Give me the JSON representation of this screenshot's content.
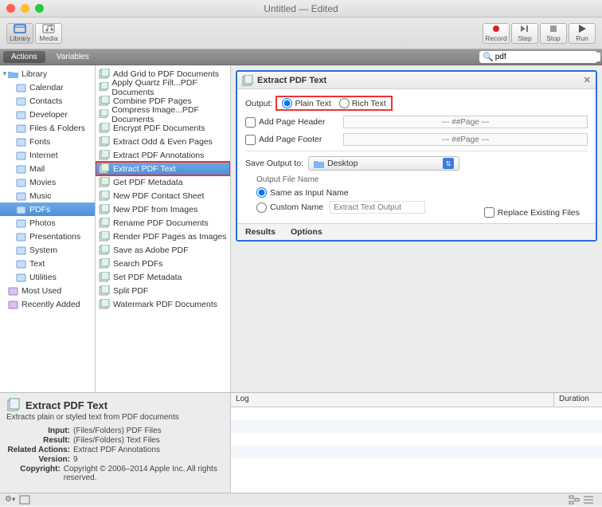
{
  "window": {
    "title": "Untitled — Edited"
  },
  "toolbar": {
    "left": [
      {
        "id": "library",
        "label": "Library"
      },
      {
        "id": "media",
        "label": "Media"
      }
    ],
    "right": [
      {
        "id": "record",
        "label": "Record"
      },
      {
        "id": "step",
        "label": "Step"
      },
      {
        "id": "stop",
        "label": "Stop"
      },
      {
        "id": "run",
        "label": "Run"
      }
    ]
  },
  "tabs": {
    "actions": "Actions",
    "variables": "Variables"
  },
  "search": {
    "value": "pdf",
    "icon": "search"
  },
  "library": {
    "root": "Library",
    "items": [
      "Calendar",
      "Contacts",
      "Developer",
      "Files & Folders",
      "Fonts",
      "Internet",
      "Mail",
      "Movies",
      "Music",
      "PDFs",
      "Photos",
      "Presentations",
      "System",
      "Text",
      "Utilities"
    ],
    "selected": "PDFs",
    "extra": [
      "Most Used",
      "Recently Added"
    ]
  },
  "actions": {
    "items": [
      "Add Grid to PDF Documents",
      "Apply Quartz Filt...PDF Documents",
      "Combine PDF Pages",
      "Compress Image...PDF Documents",
      "Encrypt PDF Documents",
      "Extract Odd & Even Pages",
      "Extract PDF Annotations",
      "Extract PDF Text",
      "Get PDF Metadata",
      "New PDF Contact Sheet",
      "New PDF from Images",
      "Rename PDF Documents",
      "Render PDF Pages as Images",
      "Save as Adobe PDF",
      "Search PDFs",
      "Set PDF Metadata",
      "Split PDF",
      "Watermark PDF Documents"
    ],
    "selected": "Extract PDF Text"
  },
  "panel": {
    "title": "Extract PDF Text",
    "output_label": "Output:",
    "opt_plain": "Plain Text",
    "opt_rich": "Rich Text",
    "add_header": "Add Page Header",
    "add_footer": "Add Page Footer",
    "page_ph": "--- ##Page ---",
    "save_to_label": "Save Output to:",
    "save_dest": "Desktop",
    "ofn_label": "Output File Name",
    "same_name": "Same as Input Name",
    "custom_name": "Custom Name",
    "custom_ph": "Extract Text Output",
    "replace": "Replace Existing Files",
    "results": "Results",
    "options": "Options"
  },
  "info": {
    "title": "Extract PDF Text",
    "desc": "Extracts plain or styled text from PDF documents",
    "rows": {
      "Input": "(Files/Folders) PDF Files",
      "Result": "(Files/Folders) Text Files",
      "Related Actions": "Extract PDF Annotations",
      "Version": "9",
      "Copyright": "Copyright © 2006–2014 Apple Inc. All rights reserved."
    }
  },
  "log": {
    "c1": "Log",
    "c2": "Duration"
  }
}
